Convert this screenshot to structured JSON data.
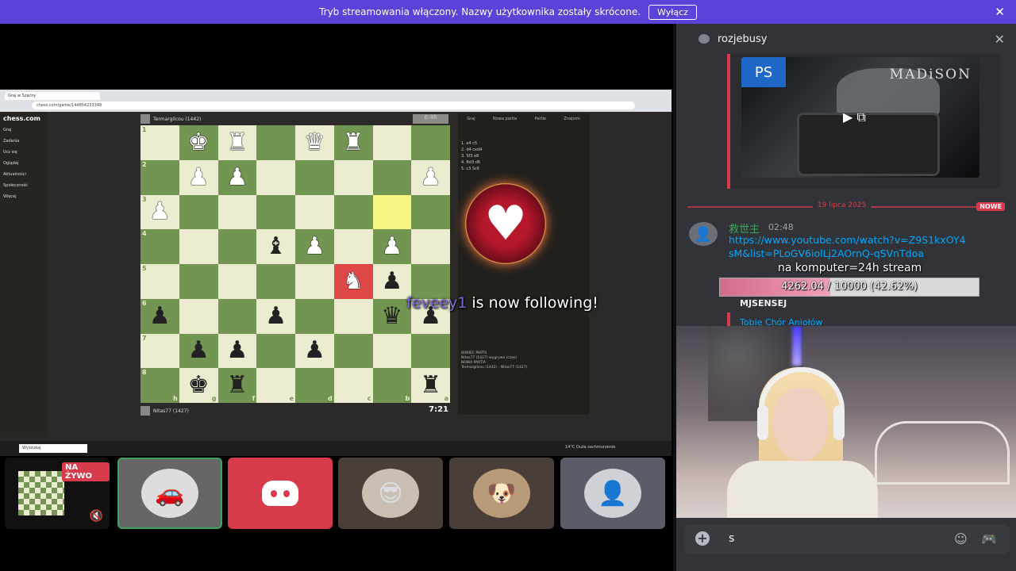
{
  "banner": {
    "message": "Tryb streamowania włączony. Nazwy użytkownika zostały skrócone.",
    "button": "Wyłącz",
    "close": "✕"
  },
  "shared_screen": {
    "url": "chess.com/game/144854233348",
    "tab": "Graj w Szachy",
    "site_logo": "chess.com",
    "nav": [
      "Graj",
      "Zadania",
      "Ucz się",
      "Oglądaj",
      "Aktualności",
      "Społeczność",
      "Więcej"
    ],
    "top_player": "Termargilcou (1442)",
    "bottom_player": "Nitas77 (1427)",
    "clock_top": "6:46",
    "clock_bottom": "7:21",
    "moves_tabs": [
      "Graj",
      "Nowa partia",
      "Partie",
      "Znajomi"
    ],
    "moves": [
      "1. e4 c5",
      "2. d4 cxd4",
      "3. Sf3 e6",
      "4. Bd3 d6",
      "5. c3 Sc6"
    ],
    "log_lines": [
      "KONIEC PARTII",
      "Nitas77 (1427) wygrywa (czas)",
      "NOWA PARTIA",
      "Termargilcou (1442) - Nitas77 (1427)"
    ],
    "taskbar_search": "Wyszukaj",
    "tray": "14°C Duże zachmurzenie"
  },
  "board": {
    "ranks": [
      "1",
      "2",
      "3",
      "4",
      "5",
      "6",
      "7",
      "8"
    ],
    "files": [
      "h",
      "g",
      "f",
      "e",
      "d",
      "c",
      "b",
      "a"
    ],
    "rows": [
      [
        "",
        "w:♚",
        "w:♜",
        "",
        "w:♛",
        "w:♜",
        "",
        ""
      ],
      [
        "",
        "w:♟",
        "w:♟",
        "",
        "",
        "",
        "",
        "w:♟"
      ],
      [
        "w:♟",
        "",
        "",
        "",
        "",
        "",
        "",
        ""
      ],
      [
        "",
        "",
        "",
        "b:♝",
        "w:♟",
        "",
        "w:♟",
        ""
      ],
      [
        "",
        "",
        "",
        "",
        "",
        "w:♞",
        "b:♟",
        ""
      ],
      [
        "b:♟",
        "",
        "",
        "b:♟",
        "",
        "",
        "b:♛",
        "b:♟"
      ],
      [
        "",
        "b:♟",
        "b:♟",
        "",
        "b:♟",
        "",
        "",
        ""
      ],
      [
        "",
        "b:♚",
        "b:♜",
        "",
        "",
        "",
        "",
        "b:♜"
      ]
    ],
    "highlight_yellow": [
      2,
      6
    ],
    "highlight_red": [
      4,
      5
    ]
  },
  "alert": {
    "name": "feveey1",
    "text": " is now following!"
  },
  "tiles": {
    "live": "NA ŻYWO",
    "mute": "🔇"
  },
  "chat": {
    "title": "rozjebusy",
    "close": "✕",
    "embed_game": "MADiSON",
    "embed_platform": "PS",
    "date": "19 lipca 2025",
    "new_badge": "NOWE",
    "author": "救世主",
    "time": "02:48",
    "link": "https://www.youtube.com/watch?v=Z9S1kxOY4sM&list=PLoGV6iolLj2AOrnQ-qSVnTdoa",
    "goal_title": "na komputer=24h stream",
    "goal_text": "4262.04 / 10000 (42.62%)",
    "goal_fraction": 0.4262,
    "reply_author": "MJSENSEJ",
    "reply_text": "Tobie Chór Aniołów",
    "composer_value": "s",
    "accent": "#d83b4b",
    "link_color": "#00a8fc"
  }
}
